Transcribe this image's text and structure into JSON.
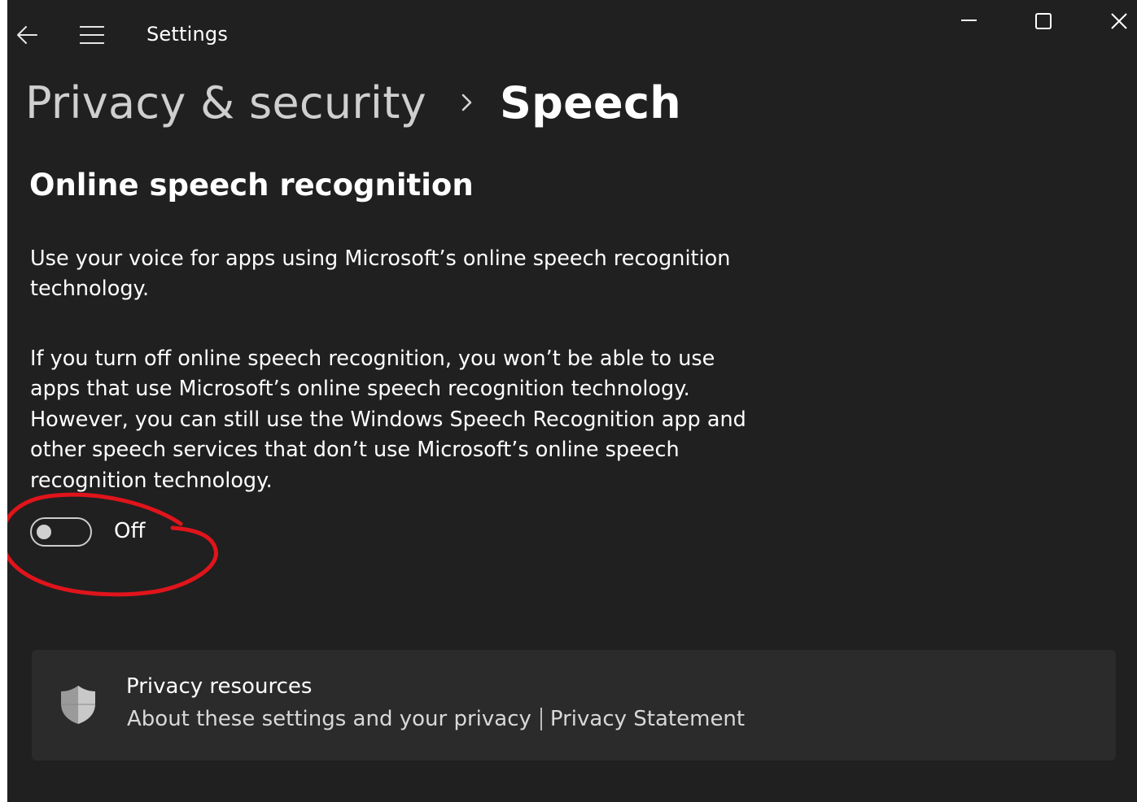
{
  "titlebar": {
    "app_title": "Settings",
    "icons": {
      "back": "arrow-left-icon",
      "menu": "hamburger-menu-icon",
      "minimize": "minimize-icon",
      "maximize": "maximize-icon",
      "close": "close-icon"
    }
  },
  "breadcrumb": {
    "parent": "Privacy & security",
    "separator_icon": "chevron-right-icon",
    "current": "Speech"
  },
  "section": {
    "title": "Online speech recognition",
    "description_1": "Use your voice for apps using Microsoft’s online speech recognition technology.",
    "description_2": "If you turn off online speech recognition, you won’t be able to use apps that use Microsoft’s online speech recognition technology.  However, you can still use the Windows Speech Recognition app and other speech services that don’t use Microsoft’s online speech recognition technology."
  },
  "toggle": {
    "state": "off",
    "label": "Off"
  },
  "annotation": {
    "shape": "hand-drawn-circle",
    "color": "#e0141b"
  },
  "privacy_resources": {
    "icon": "shield-icon",
    "title": "Privacy resources",
    "link_1": "About these settings and your privacy",
    "link_2": "Privacy Statement"
  },
  "colors": {
    "background": "#202020",
    "card": "#2b2b2b",
    "text": "#ffffff",
    "muted_text": "#cfcfcf",
    "annotation_red": "#e0141b"
  }
}
